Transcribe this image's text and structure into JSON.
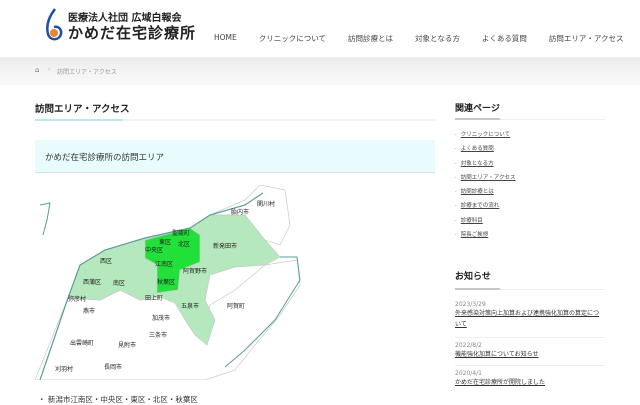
{
  "header": {
    "logo_sub": "医療法人社団 広域白報会",
    "logo_main": "かめだ在宅診療所",
    "logo_colors": {
      "blue": "#1f4fa0",
      "orange": "#e8862a"
    }
  },
  "nav": [
    "HOME",
    "クリニックについて",
    "訪問診療とは",
    "対象となる方",
    "よくある質問",
    "訪問エリア・アクセス"
  ],
  "breadcrumb": {
    "home_icon": "home-icon",
    "current": "訪問エリア・アクセス"
  },
  "main": {
    "title": "訪問エリア・アクセス",
    "box_heading": "かめだ在宅診療所の訪問エリア",
    "area_list": "・ 新潟市江南区・中央区・東区・北区・秋葉区",
    "map": {
      "colors": {
        "service": "#22e03a",
        "nearby": "#b5e9bd",
        "other": "#ffffff",
        "border": "#c8c8c8",
        "coast": "#5b9c9c"
      },
      "service_areas": [
        "東区",
        "北区",
        "中央区",
        "江南区",
        "秋葉区"
      ],
      "labels": [
        "関川村",
        "胎内市",
        "聖籠町",
        "東区",
        "北区",
        "中央区",
        "新発田市",
        "西区",
        "江南区",
        "阿賀野市",
        "西蒲区",
        "南区",
        "秋葉区",
        "弥彦村",
        "田上町",
        "燕市",
        "五泉市",
        "阿賀町",
        "加茂市",
        "三条市",
        "出雲崎町",
        "見附市",
        "刈羽村",
        "長岡市"
      ]
    }
  },
  "sidebar": {
    "related_title": "関連ページ",
    "related": [
      "クリニックについて",
      "よくある質問",
      "対象となる方",
      "訪問エリア・アクセス",
      "訪問診療とは",
      "診療までの流れ",
      "診療科目",
      "院長ご挨拶"
    ],
    "news_title": "お知らせ",
    "news": [
      {
        "date": "2023/3/29",
        "title": "外来感染対策向上加算および連携強化加算の算定について"
      },
      {
        "date": "2022/8/2",
        "title": "機能強化加算についてお知らせ"
      },
      {
        "date": "2020/4/1",
        "title": "かめだ在宅診療所が開院しました"
      }
    ]
  }
}
